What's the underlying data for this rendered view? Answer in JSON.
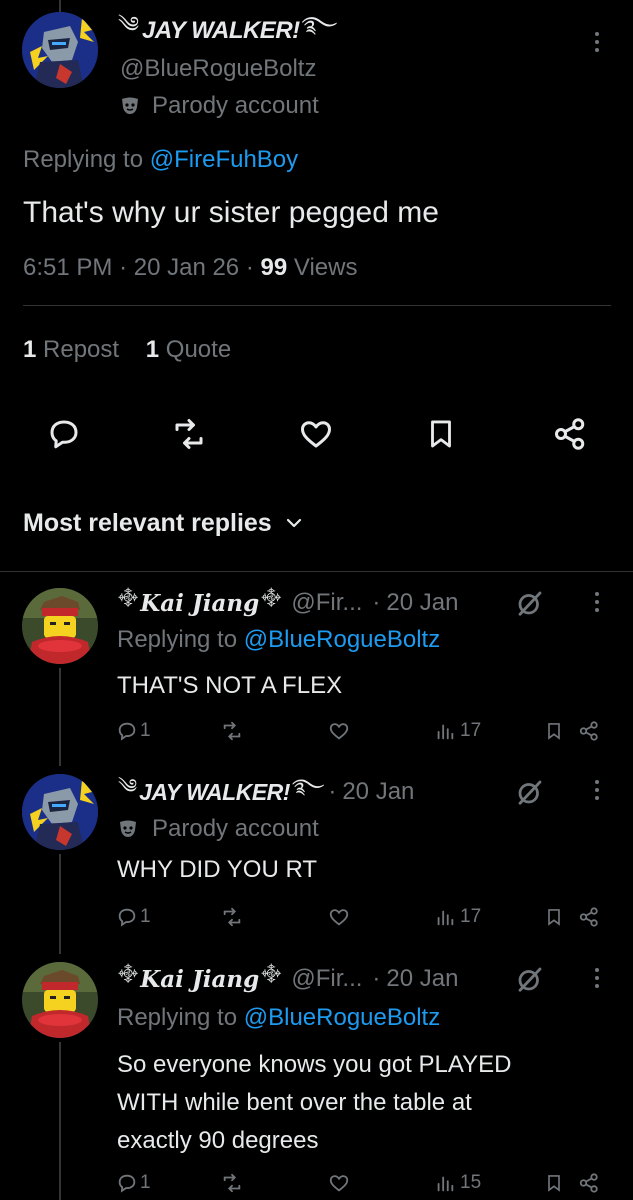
{
  "main_tweet": {
    "display_name": "JAY WALKER!",
    "handle": "@BlueRogueBoltz",
    "parody_label": "Parody account",
    "replying_prefix": "Replying to",
    "replying_to": "@FireFuhBoy",
    "text": "That's why ur sister pegged me",
    "time": "6:51 PM",
    "sep1": "·",
    "date": "20 Jan 26",
    "sep2": "·",
    "views_count": "99",
    "views_label": "Views",
    "reposts_count": "1",
    "reposts_label": "Repost",
    "quotes_count": "1",
    "quotes_label": "Quote"
  },
  "replies_header": {
    "label": "Most relevant replies"
  },
  "replies": [
    {
      "display_name": "Kai Jiang",
      "handle": "@Fir...",
      "sep": "·",
      "date": "20 Jan",
      "replying_prefix": "Replying to",
      "replying_to": "@BlueRogueBoltz",
      "text": "THAT'S NOT A FLEX",
      "reply_count": "1",
      "views": "17"
    },
    {
      "display_name": "JAY WALKER!",
      "sep": "·",
      "date": "20 Jan",
      "parody_label": "Parody account",
      "text": "WHY DID YOU RT",
      "reply_count": "1",
      "views": "17"
    },
    {
      "display_name": "Kai Jiang",
      "handle": "@Fir...",
      "sep": "·",
      "date": "20 Jan",
      "replying_prefix": "Replying to",
      "replying_to": "@BlueRogueBoltz",
      "text_lines": [
        "So everyone knows you got PLAYED",
        "WITH while bent over the table at",
        "exactly 90 degrees"
      ],
      "reply_count": "1",
      "views": "15"
    }
  ],
  "colors": {
    "background": "#000000",
    "text": "#e7e9ea",
    "secondary": "#71767b",
    "accent": "#1d9bf0",
    "divider": "#2f3336"
  },
  "icons": [
    "more-icon",
    "parody-mask-icon",
    "reply-icon",
    "repost-icon",
    "like-icon",
    "bookmark-icon",
    "share-icon",
    "chevron-down-icon",
    "views-icon",
    "grok-icon"
  ]
}
